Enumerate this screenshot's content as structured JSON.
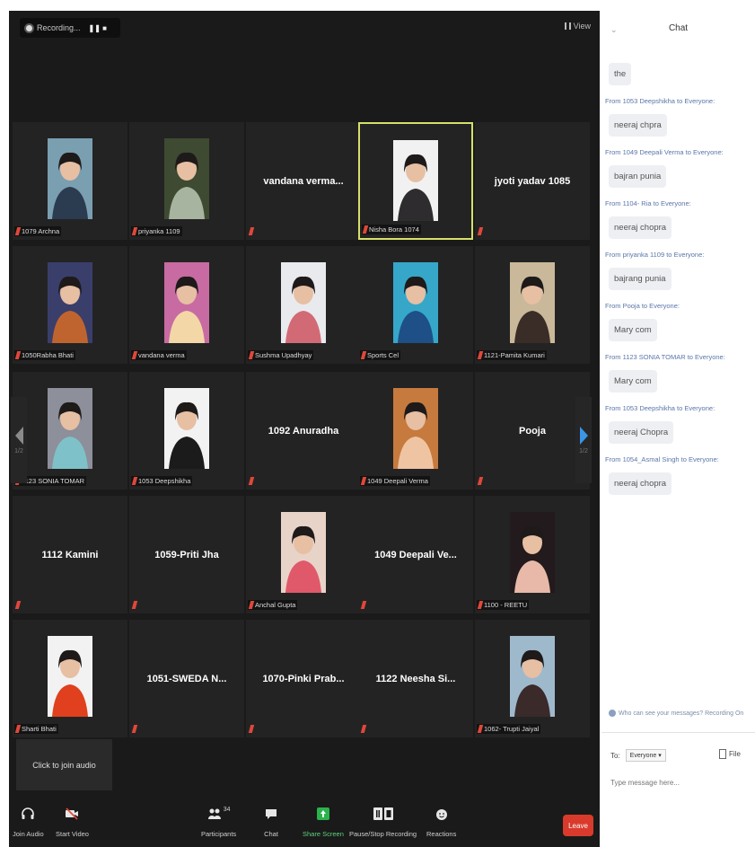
{
  "recording": {
    "label": "Recording...",
    "controls": "❚❚ ■"
  },
  "view": {
    "label": "View"
  },
  "tiles": [
    {
      "kind": "photo",
      "label": "1079 Archna",
      "bg": "#7a9fb0",
      "fg": "#2b3b50"
    },
    {
      "kind": "photo",
      "label": "priyanka 1109",
      "bg": "#3e4a32",
      "fg": "#a7b4a0"
    },
    {
      "kind": "name",
      "name": "vandana verma..."
    },
    {
      "kind": "photo",
      "label": "Nisha Bora 1074",
      "bg": "#f1f1f1",
      "fg": "#2f2c30",
      "active": true
    },
    {
      "kind": "name",
      "name": "jyoti yadav 1085"
    },
    {
      "kind": "photo",
      "label": "1050Rabha Bhati",
      "bg": "#3a3e6a",
      "fg": "#c0642f"
    },
    {
      "kind": "photo",
      "label": "vandana verma",
      "bg": "#c86ba2",
      "fg": "#f3d7a7"
    },
    {
      "kind": "photo",
      "label": "Sushma Upadhyay",
      "bg": "#e9eaed",
      "fg": "#d26a75"
    },
    {
      "kind": "photo",
      "label": "Sports Cel",
      "bg": "#36a7c9",
      "fg": "#1e4f86"
    },
    {
      "kind": "photo",
      "label": "1121-Pamita Kumari",
      "bg": "#c9b89a",
      "fg": "#3a2c26"
    },
    {
      "kind": "photo",
      "label": "1123 SONIA TOMAR",
      "bg": "#8d8f9a",
      "fg": "#7fc1c8"
    },
    {
      "kind": "photo",
      "label": "1053 Deepshikha",
      "bg": "#f2f2f2",
      "fg": "#1b1b1b"
    },
    {
      "kind": "name",
      "name": "1092 Anuradha"
    },
    {
      "kind": "photo",
      "label": "1049 Deepali Verma",
      "bg": "#c77a3d",
      "fg": "#efc4a3"
    },
    {
      "kind": "name",
      "name": "Pooja"
    },
    {
      "kind": "name",
      "name": "1112 Kamini"
    },
    {
      "kind": "name",
      "name": "1059-Priti Jha"
    },
    {
      "kind": "photo",
      "label": "Anchal Gupta",
      "bg": "#e8d3c9",
      "fg": "#e0596a"
    },
    {
      "kind": "name",
      "name": "1049 Deepali Ve..."
    },
    {
      "kind": "photo",
      "label": "1100 - REETU",
      "bg": "#221a1c",
      "fg": "#e8b9a8"
    },
    {
      "kind": "photo",
      "label": "Sharti Bhati",
      "bg": "#f2f2f2",
      "fg": "#e0401e"
    },
    {
      "kind": "name",
      "name": "1051-SWEDA N..."
    },
    {
      "kind": "name",
      "name": "1070-Pinki Prab..."
    },
    {
      "kind": "name",
      "name": "1122 Neesha Si..."
    },
    {
      "kind": "photo",
      "label": "1062- Trupti Jaiyal",
      "bg": "#9fb9cc",
      "fg": "#3a2a2a"
    }
  ],
  "pager": {
    "left_num": "1/2",
    "right_num": "1/2"
  },
  "audio_popup": {
    "text": "Click to join audio"
  },
  "toolbar": {
    "join_audio": "Join Audio",
    "start_video": "Start Video",
    "participants": "Participants",
    "participant_count": "34",
    "chat": "Chat",
    "share_screen": "Share Screen",
    "recording": "Pause/Stop Recording",
    "reactions": "Reactions",
    "leave": "Leave"
  },
  "chat": {
    "title": "Chat",
    "messages": [
      {
        "from": "",
        "text": "the"
      },
      {
        "from": "From 1053 Deepshikha to Everyone:",
        "text": "neeraj chpra"
      },
      {
        "from": "From 1049 Deepali Verma to Everyone:",
        "text": "bajran punia"
      },
      {
        "from": "From 1104- Ria to Everyone:",
        "text": "neeraj chopra"
      },
      {
        "from": "From priyanka 1109 to Everyone:",
        "text": "bajrang punia"
      },
      {
        "from": "From Pooja to Everyone:",
        "text": "Mary com"
      },
      {
        "from": "From 1123 SONIA TOMAR to Everyone:",
        "text": "Mary com"
      },
      {
        "from": "From 1053 Deepshikha to Everyone:",
        "text": "neeraj Chopra"
      },
      {
        "from": "From 1054_Asmal Singh to Everyone:",
        "text": "neeraj chopra"
      }
    ],
    "note": "Who can see your messages? Recording On",
    "to_label": "To:",
    "to_value": "Everyone ▾",
    "file_label": "File",
    "placeholder": "Type message here..."
  },
  "colors": {
    "meeting_bg": "#1a1a1a",
    "tile_bg": "#232323",
    "active_border": "#d6e06a",
    "leave": "#d93a2b",
    "accent": "#3a95e6"
  }
}
